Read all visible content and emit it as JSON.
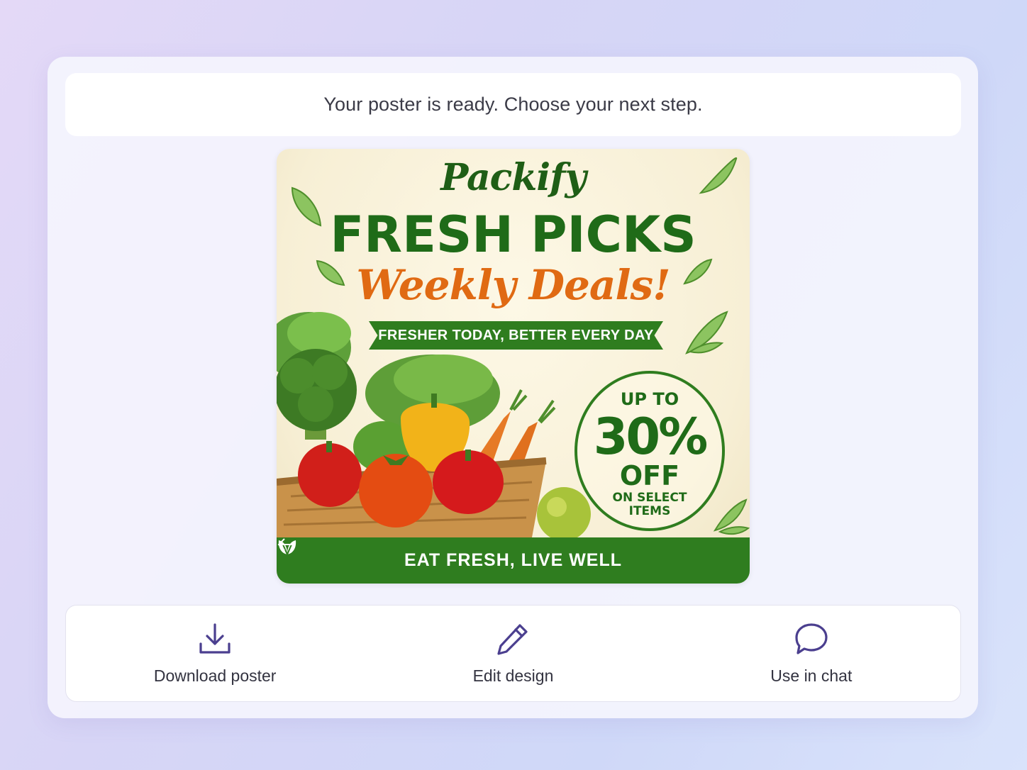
{
  "status_message": "Your poster is ready. Choose your next step.",
  "poster": {
    "brand": "Packify",
    "headline": "FRESH PICKS",
    "subheadline": "Weekly Deals!",
    "ribbon": "FRESHER TODAY, BETTER EVERY DAY",
    "badge": {
      "line1": "UP TO",
      "line2": "30%",
      "line3": "OFF",
      "line4": "ON SELECT ITEMS"
    },
    "footer": "EAT FRESH, LIVE WELL",
    "colors": {
      "green": "#2f7d1f",
      "orange": "#e06a13",
      "cream": "#fdf8e6"
    }
  },
  "actions": [
    {
      "label": "Download poster",
      "icon": "download-icon"
    },
    {
      "label": "Edit design",
      "icon": "pencil-icon"
    },
    {
      "label": "Use in chat",
      "icon": "chat-bubble-icon"
    }
  ],
  "accent_color": "#4b3f8f"
}
